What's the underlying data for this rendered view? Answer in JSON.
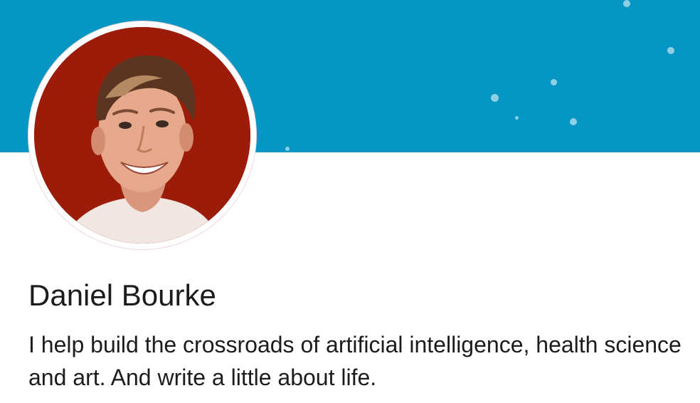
{
  "profile": {
    "name": "Daniel Bourke",
    "bio": "I help build the crossroads of artificial intelligence, health science and art. And write a little about life."
  },
  "colors": {
    "cover": "#0596c4",
    "avatar_background": "#9b1c08",
    "text": "#1c1c1c"
  }
}
